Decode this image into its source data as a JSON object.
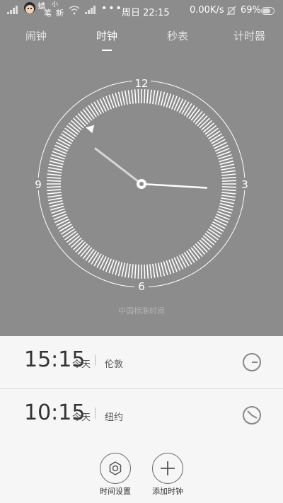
{
  "status_bar": {
    "time": "周日 22:15",
    "speed": "0.00K/s",
    "battery": "69%",
    "sticker_text": [
      "蜡",
      "笔",
      "小",
      "新"
    ]
  },
  "tabs": [
    {
      "label": "闹钟",
      "active": false
    },
    {
      "label": "时钟",
      "active": true
    },
    {
      "label": "秒表",
      "active": false
    },
    {
      "label": "计时器",
      "active": false
    }
  ],
  "clock": {
    "hour_labels": {
      "top": "12",
      "right": "3",
      "bottom": "6",
      "left": "9"
    },
    "hour": 22,
    "minute": 15,
    "timezone_label": "中国标准时间"
  },
  "world_clocks": [
    {
      "time": "15:15",
      "day": "今天",
      "city": "伦敦"
    },
    {
      "time": "10:15",
      "day": "今天",
      "city": "纽约"
    }
  ],
  "actions": [
    {
      "label": "时间设置",
      "icon": "settings-icon"
    },
    {
      "label": "添加时钟",
      "icon": "plus-icon"
    }
  ],
  "colors": {
    "header_bg": "#8c8c8c",
    "list_bg": "#f6f6f6"
  }
}
